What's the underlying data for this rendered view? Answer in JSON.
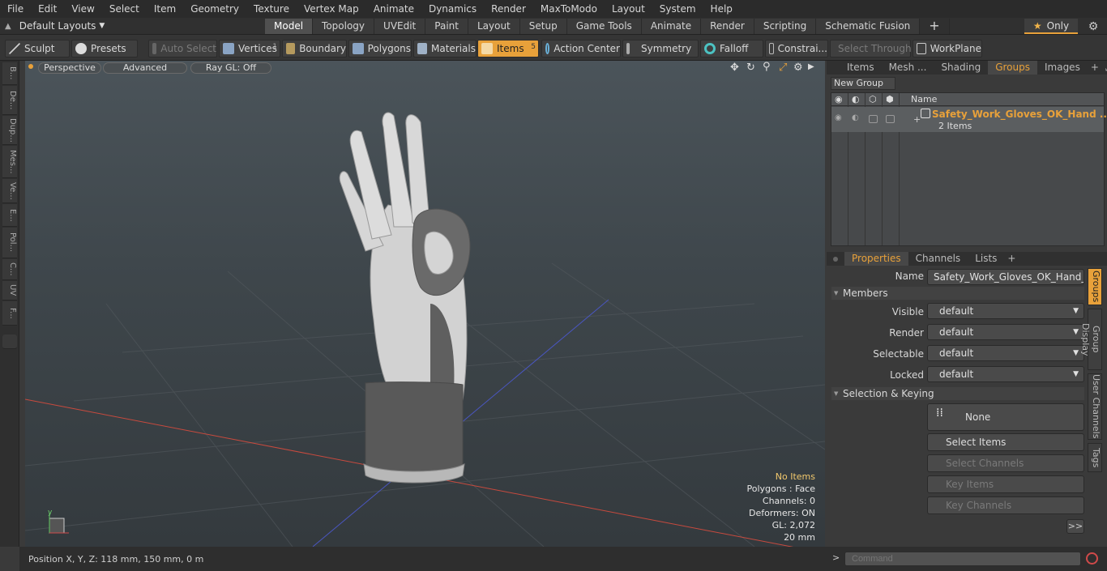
{
  "menubar": [
    "File",
    "Edit",
    "View",
    "Select",
    "Item",
    "Geometry",
    "Texture",
    "Vertex Map",
    "Animate",
    "Dynamics",
    "Render",
    "MaxToModo",
    "Layout",
    "System",
    "Help"
  ],
  "layout_selector": {
    "label": "Default Layouts"
  },
  "tabs": [
    "Model",
    "Topology",
    "UVEdit",
    "Paint",
    "Layout",
    "Setup",
    "Game Tools",
    "Animate",
    "Render",
    "Scripting",
    "Schematic Fusion"
  ],
  "tabs_plus": "+",
  "only_button": {
    "label": "Only"
  },
  "toolbar": {
    "sculpt": "Sculpt",
    "presets": "Presets",
    "auto_select": "Auto Select",
    "vertices": "Vertices",
    "vertices_count": "1",
    "boundary": "Boundary",
    "polygons": "Polygons",
    "materials": "Materials",
    "items": "Items",
    "items_count": "5",
    "action_center": "Action Center",
    "symmetry": "Symmetry",
    "falloff": "Falloff",
    "constraints": "Constrai...",
    "select_through": "Select Through",
    "workplane": "WorkPlane"
  },
  "left_tools": [
    "B...",
    "De...",
    "Dup...",
    "Mes...",
    "Ve...",
    "E...",
    "Pol...",
    "C...",
    "UV",
    "F..."
  ],
  "viewport": {
    "perspective": "Perspective",
    "advanced": "Advanced",
    "raygl": "Ray GL: Off",
    "hud": {
      "no_items": "No Items",
      "polygons": "Polygons : Face",
      "channels": "Channels: 0",
      "deformers": "Deformers: ON",
      "gl": "GL: 2,072",
      "scale": "20 mm"
    }
  },
  "statusbar": {
    "position": "Position X, Y, Z:   118 mm, 150 mm, 0 m"
  },
  "right_tabs": [
    "Items",
    "Mesh ...",
    "Shading",
    "Groups",
    "Images"
  ],
  "right_tabs_plus": "+",
  "groups": {
    "new_group": "New Group",
    "col_name": "Name",
    "group_name": "Safety_Work_Gloves_OK_Hand ...",
    "group_count": "2 Items"
  },
  "prop_tabs": [
    "Properties",
    "Channels",
    "Lists"
  ],
  "prop_tabs_plus": "+",
  "properties": {
    "name_label": "Name",
    "name_value": "Safety_Work_Gloves_OK_Hand_Gesti",
    "members": "Members",
    "visible_label": "Visible",
    "visible_value": "default",
    "render_label": "Render",
    "render_value": "default",
    "selectable_label": "Selectable",
    "selectable_value": "default",
    "locked_label": "Locked",
    "locked_value": "default",
    "selection_keying": "Selection & Keying",
    "none": "None",
    "select_items": "Select Items",
    "select_channels": "Select Channels",
    "key_items": "Key Items",
    "key_channels": "Key Channels",
    "more": ">>"
  },
  "vertical_tabs": [
    "Groups",
    "Group Display",
    "User Channels",
    "Tags"
  ],
  "command": {
    "prompt": ">",
    "placeholder": "Command"
  },
  "colors": {
    "accent": "#e8a13a",
    "viewport_top": "#4b545a",
    "viewport_bottom": "#343a3e"
  }
}
